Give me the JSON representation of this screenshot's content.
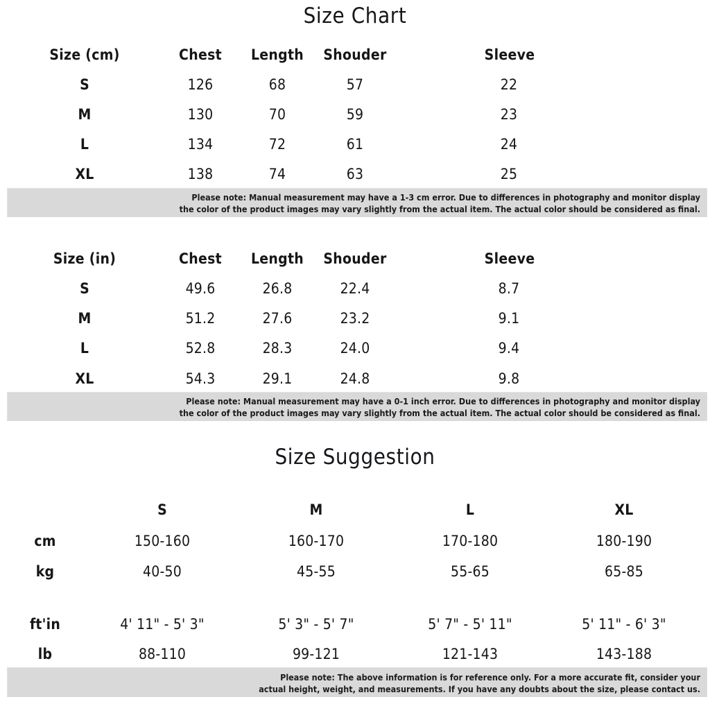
{
  "titles": {
    "size_chart": "Size Chart",
    "size_suggestion": "Size Suggestion"
  },
  "table_cm": {
    "headers": [
      "Size (cm)",
      "Chest",
      "Length",
      "Shouder",
      "Sleeve"
    ],
    "rows": [
      {
        "size": "S",
        "chest": "126",
        "length": "68",
        "shoulder": "57",
        "sleeve": "22"
      },
      {
        "size": "M",
        "chest": "130",
        "length": "70",
        "shoulder": "59",
        "sleeve": "23"
      },
      {
        "size": "L",
        "chest": "134",
        "length": "72",
        "shoulder": "61",
        "sleeve": "24"
      },
      {
        "size": "XL",
        "chest": "138",
        "length": "74",
        "shoulder": "63",
        "sleeve": "25"
      }
    ]
  },
  "note_cm": {
    "line1": "Please note: Manual measurement may have a 1-3 cm error. Due to differences in photography and monitor display",
    "line2": "the color of the product images may vary slightly from the actual item. The actual color should be considered as final."
  },
  "table_in": {
    "headers": [
      "Size (in)",
      "Chest",
      "Length",
      "Shouder",
      "Sleeve"
    ],
    "rows": [
      {
        "size": "S",
        "chest": "49.6",
        "length": "26.8",
        "shoulder": "22.4",
        "sleeve": "8.7"
      },
      {
        "size": "M",
        "chest": "51.2",
        "length": "27.6",
        "shoulder": "23.2",
        "sleeve": "9.1"
      },
      {
        "size": "L",
        "chest": "52.8",
        "length": "28.3",
        "shoulder": "24.0",
        "sleeve": "9.4"
      },
      {
        "size": "XL",
        "chest": "54.3",
        "length": "29.1",
        "shoulder": "24.8",
        "sleeve": "9.8"
      }
    ]
  },
  "note_in": {
    "line1": "Please note: Manual measurement may have a 0-1 inch error. Due to differences in photography and monitor display",
    "line2": "the color of the product images may vary slightly from the actual item. The actual color should be considered as final."
  },
  "table_suggestion": {
    "column_headers": [
      "S",
      "M",
      "L",
      "XL"
    ],
    "row_labels": [
      "cm",
      "kg",
      "ft'in",
      "lb"
    ],
    "rows": [
      {
        "label": "cm",
        "S": "150-160",
        "M": "160-170",
        "L": "170-180",
        "XL": "180-190"
      },
      {
        "label": "kg",
        "S": "40-50",
        "M": "45-55",
        "L": "55-65",
        "XL": "65-85"
      },
      {
        "label": "ft'in",
        "S": "4' 11\" - 5' 3\"",
        "M": "5' 3\" - 5' 7\"",
        "L": "5' 7\" - 5' 11\"",
        "XL": "5' 11\" - 6' 3\""
      },
      {
        "label": "lb",
        "S": "88-110",
        "M": "99-121",
        "L": "121-143",
        "XL": "143-188"
      }
    ]
  },
  "note_suggestion": {
    "line1": "Please note: The above information is for reference only. For a more accurate fit, consider your",
    "line2": "actual height, weight, and measurements. If you have any doubts about the size, please contact us."
  },
  "colors": {
    "background": "#ffffff",
    "text": "#161616",
    "note_band": "#d9d9d9"
  }
}
